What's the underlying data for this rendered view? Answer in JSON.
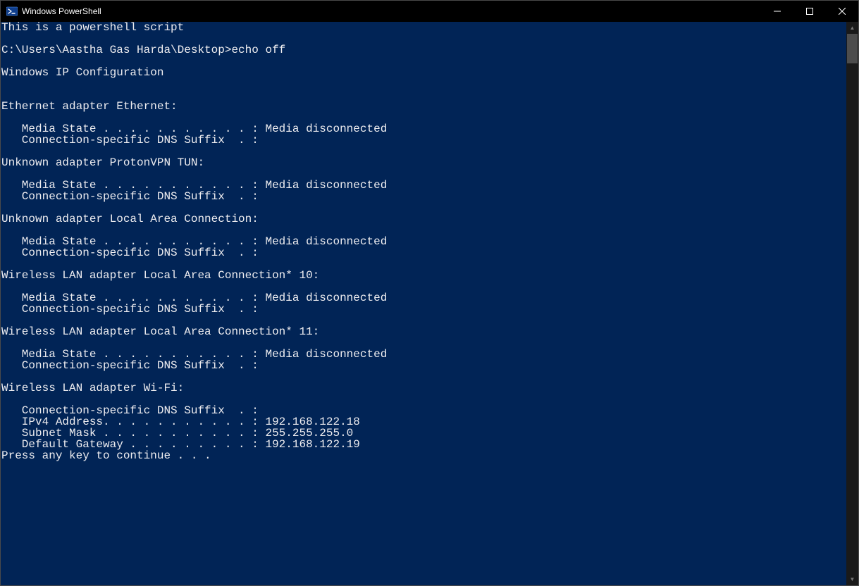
{
  "window": {
    "title": "Windows PowerShell"
  },
  "terminal": {
    "lines": [
      "This is a powershell script",
      "",
      "C:\\Users\\Aastha Gas Harda\\Desktop>echo off",
      "",
      "Windows IP Configuration",
      "",
      "",
      "Ethernet adapter Ethernet:",
      "",
      "   Media State . . . . . . . . . . . : Media disconnected",
      "   Connection-specific DNS Suffix  . :",
      "",
      "Unknown adapter ProtonVPN TUN:",
      "",
      "   Media State . . . . . . . . . . . : Media disconnected",
      "   Connection-specific DNS Suffix  . :",
      "",
      "Unknown adapter Local Area Connection:",
      "",
      "   Media State . . . . . . . . . . . : Media disconnected",
      "   Connection-specific DNS Suffix  . :",
      "",
      "Wireless LAN adapter Local Area Connection* 10:",
      "",
      "   Media State . . . . . . . . . . . : Media disconnected",
      "   Connection-specific DNS Suffix  . :",
      "",
      "Wireless LAN adapter Local Area Connection* 11:",
      "",
      "   Media State . . . . . . . . . . . : Media disconnected",
      "   Connection-specific DNS Suffix  . :",
      "",
      "Wireless LAN adapter Wi-Fi:",
      "",
      "   Connection-specific DNS Suffix  . :",
      "   IPv4 Address. . . . . . . . . . . : 192.168.122.18",
      "   Subnet Mask . . . . . . . . . . . : 255.255.255.0",
      "   Default Gateway . . . . . . . . . : 192.168.122.19",
      "Press any key to continue . . ."
    ]
  }
}
